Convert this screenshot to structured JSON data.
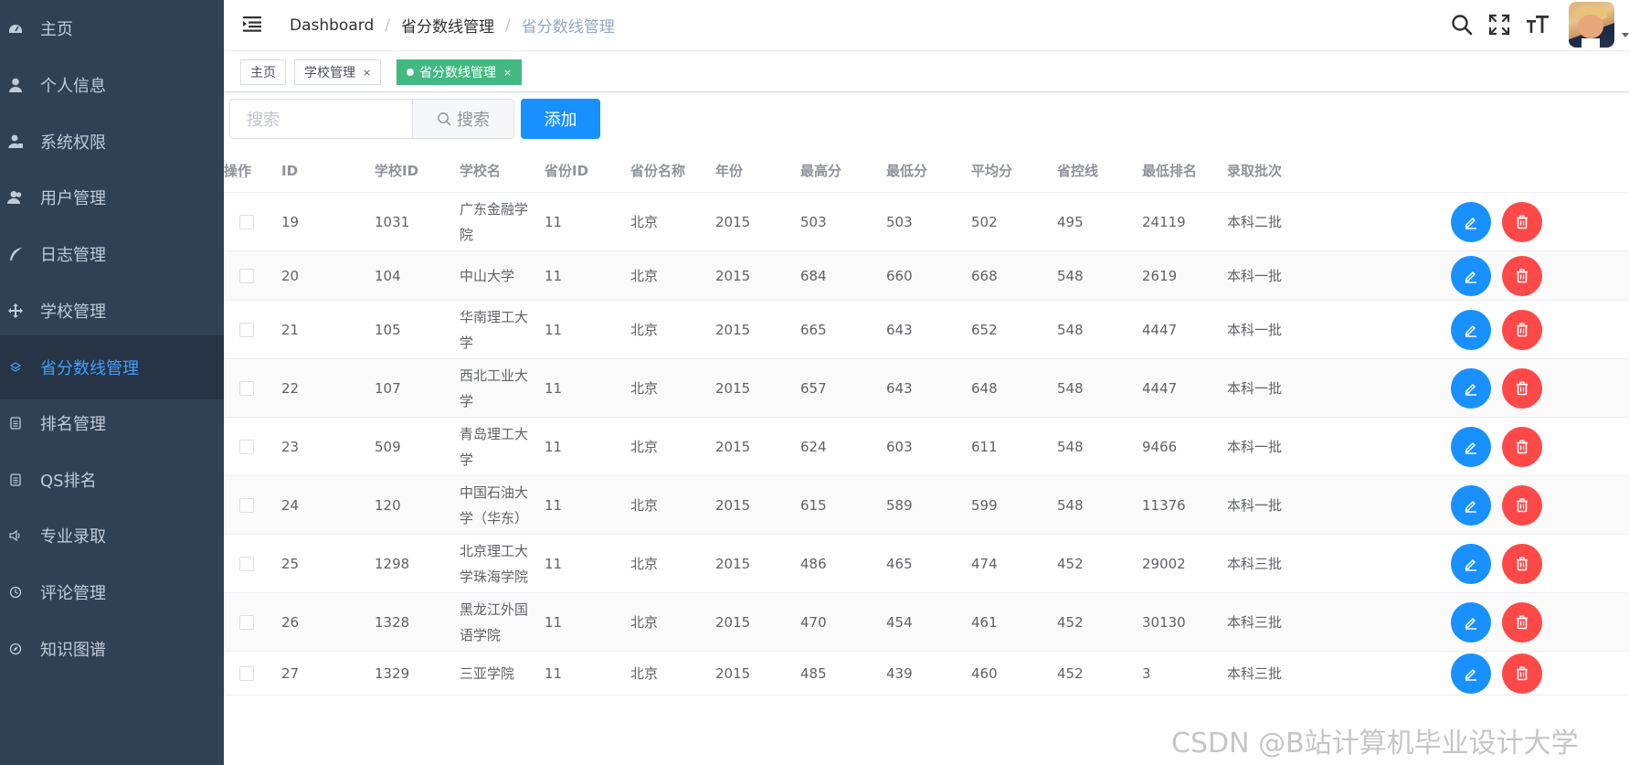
{
  "sidebar": {
    "items": [
      {
        "label": "主页",
        "icon": "dashboard-icon"
      },
      {
        "label": "个人信息",
        "icon": "user-icon"
      },
      {
        "label": "系统权限",
        "icon": "user-lock-icon"
      },
      {
        "label": "用户管理",
        "icon": "users-icon"
      },
      {
        "label": "日志管理",
        "icon": "feather-icon"
      },
      {
        "label": "学校管理",
        "icon": "move-icon"
      },
      {
        "label": "省分数线管理",
        "icon": "layers-icon"
      },
      {
        "label": "排名管理",
        "icon": "document-icon"
      },
      {
        "label": "QS排名",
        "icon": "document-icon"
      },
      {
        "label": "专业录取",
        "icon": "speaker-icon"
      },
      {
        "label": "评论管理",
        "icon": "clock-icon"
      },
      {
        "label": "知识图谱",
        "icon": "compass-icon"
      }
    ],
    "active_label": "省分数线管理"
  },
  "navbar": {
    "breadcrumb": [
      "Dashboard",
      "省分数线管理",
      "省分数线管理"
    ],
    "separator": "/"
  },
  "tags": [
    {
      "label": "主页",
      "closable": false,
      "active": false
    },
    {
      "label": "学校管理",
      "closable": true,
      "active": false
    },
    {
      "label": "省分数线管理",
      "closable": true,
      "active": true
    }
  ],
  "tag_close": "×",
  "search": {
    "placeholder": "搜索",
    "button_label": "搜索"
  },
  "add_button_label": "添加",
  "table": {
    "headers": [
      "ID",
      "学校ID",
      "学校名",
      "省份ID",
      "省份名称",
      "年份",
      "最高分",
      "最低分",
      "平均分",
      "省控线",
      "最低排名",
      "录取批次",
      "操作"
    ],
    "rows": [
      [
        "19",
        "1031",
        "广东金融学院",
        "11",
        "北京",
        "2015",
        "503",
        "503",
        "502",
        "495",
        "24119",
        "本科二批"
      ],
      [
        "20",
        "104",
        "中山大学",
        "11",
        "北京",
        "2015",
        "684",
        "660",
        "668",
        "548",
        "2619",
        "本科一批"
      ],
      [
        "21",
        "105",
        "华南理工大学",
        "11",
        "北京",
        "2015",
        "665",
        "643",
        "652",
        "548",
        "4447",
        "本科一批"
      ],
      [
        "22",
        "107",
        "西北工业大学",
        "11",
        "北京",
        "2015",
        "657",
        "643",
        "648",
        "548",
        "4447",
        "本科一批"
      ],
      [
        "23",
        "509",
        "青岛理工大学",
        "11",
        "北京",
        "2015",
        "624",
        "603",
        "611",
        "548",
        "9466",
        "本科一批"
      ],
      [
        "24",
        "120",
        "中国石油大学（华东）",
        "11",
        "北京",
        "2015",
        "615",
        "589",
        "599",
        "548",
        "11376",
        "本科一批"
      ],
      [
        "25",
        "1298",
        "北京理工大学珠海学院",
        "11",
        "北京",
        "2015",
        "486",
        "465",
        "474",
        "452",
        "29002",
        "本科三批"
      ],
      [
        "26",
        "1328",
        "黑龙江外国语学院",
        "11",
        "北京",
        "2015",
        "470",
        "454",
        "461",
        "452",
        "30130",
        "本科三批"
      ],
      [
        "27",
        "1329",
        "三亚学院",
        "11",
        "北京",
        "2015",
        "485",
        "439",
        "460",
        "452",
        "3",
        "本科三批"
      ]
    ]
  },
  "watermark": "CSDN @B站计算机毕业设计大学",
  "colors": {
    "sidebar_bg": "#304156",
    "active": "#409eff",
    "primary": "#1890ff",
    "danger": "#ff4949",
    "tag_active": "#42b983"
  }
}
